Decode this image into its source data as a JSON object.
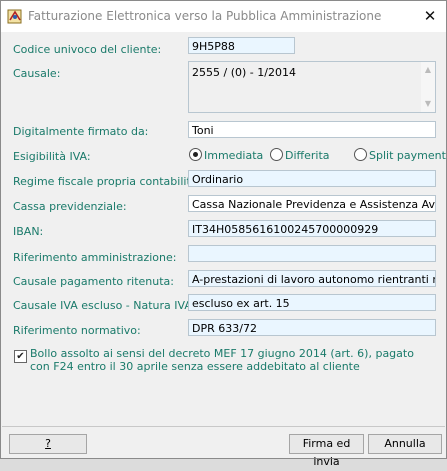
{
  "window": {
    "title": "Fatturazione Elettronica verso la Pubblica Amministrazione",
    "close_glyph": "✕"
  },
  "form": {
    "codice_univoco": {
      "label": "Codice univoco del cliente:",
      "value": "9H5P88"
    },
    "causale": {
      "label": "Causale:",
      "value": "2555 /  (0) - 1/2014"
    },
    "firmato": {
      "label": "Digitalmente firmato da:",
      "value": "Toni"
    },
    "esigibilita": {
      "label": "Esigibilità IVA:",
      "options": [
        "Immediata",
        "Differita",
        "Split payment"
      ],
      "selected": "Immediata"
    },
    "regime": {
      "label": "Regime fiscale propria contabilità:",
      "value": "Ordinario"
    },
    "cassa": {
      "label": "Cassa previdenziale:",
      "value": "Cassa Nazionale Previdenza e Assistenza Avvocati"
    },
    "iban": {
      "label": "IBAN:",
      "value": "IT34H0585616100245700000929"
    },
    "rif_amministrazione": {
      "label": "Riferimento amministrazione:",
      "value": ""
    },
    "causale_ritenuta": {
      "label": "Causale pagamento ritenuta:",
      "value": "A-prestazioni di lavoro autonomo rientranti nell'ese"
    },
    "causale_iva": {
      "label": "Causale IVA escluso - Natura IVA:",
      "value": "escluso ex art. 15"
    },
    "rif_normativo": {
      "label": "Riferimento normativo:",
      "value": "DPR 633/72"
    },
    "bollo": {
      "checked": true,
      "text": "Bollo assolto ai sensi del decreto MEF 17 giugno 2014 (art. 6), pagato con F24 entro il 30 aprile senza essere addebitato al cliente"
    }
  },
  "buttons": {
    "help": "?",
    "sign": "Firma ed invia",
    "cancel": "Annulla"
  },
  "colors": {
    "label": "#1a7a6a",
    "field_bg": "#eaf6ff"
  }
}
